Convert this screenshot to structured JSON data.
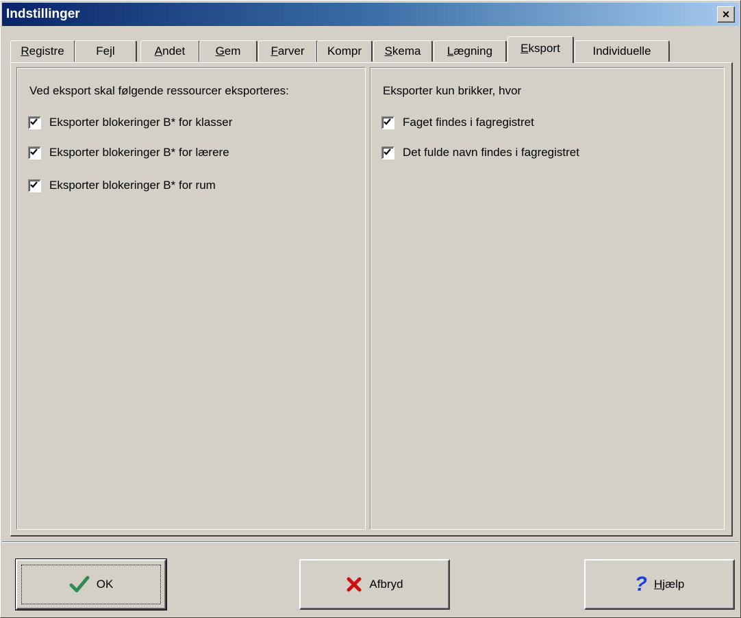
{
  "window": {
    "title": "Indstillinger",
    "close_label": "×"
  },
  "tabs": [
    {
      "label": "Registre",
      "u": "R",
      "rest": "egistre"
    },
    {
      "label": "Fejl",
      "u": "",
      "pre": "Fe",
      "mid": "j",
      "post": "l"
    },
    {
      "label": "Andet",
      "u": "A",
      "rest": "ndet"
    },
    {
      "label": "Gem",
      "u": "G",
      "rest": "em"
    },
    {
      "label": "Farver",
      "u": "F",
      "rest": "arver"
    },
    {
      "label": "Kompr"
    },
    {
      "label": "Skema",
      "u": "S",
      "rest": "kema"
    },
    {
      "label": "Lægning",
      "u": "L",
      "rest": "ægning"
    },
    {
      "label": "Eksport",
      "u": "E",
      "rest": "ksport",
      "active": true
    },
    {
      "label": "Individuelle"
    }
  ],
  "left_group": {
    "heading": "Ved eksport skal følgende ressourcer eksporteres:",
    "options": [
      {
        "label": "Eksporter blokeringer B* for klasser",
        "checked": true
      },
      {
        "label": "Eksporter blokeringer B* for lærere",
        "checked": true
      },
      {
        "label": "Eksporter blokeringer B* for rum",
        "checked": true
      }
    ]
  },
  "right_group": {
    "heading": "Eksporter kun brikker, hvor",
    "options": [
      {
        "label": "Faget findes i fagregistret",
        "checked": true
      },
      {
        "label": "Det fulde navn findes i fagregistret",
        "checked": true
      }
    ]
  },
  "buttons": {
    "ok": "OK",
    "cancel": "Afbryd",
    "help_u": "H",
    "help_rest": "jælp"
  },
  "colors": {
    "ok_icon": "#2e8b57",
    "cancel_icon": "#d01010",
    "help_icon": "#1a3fd6"
  }
}
